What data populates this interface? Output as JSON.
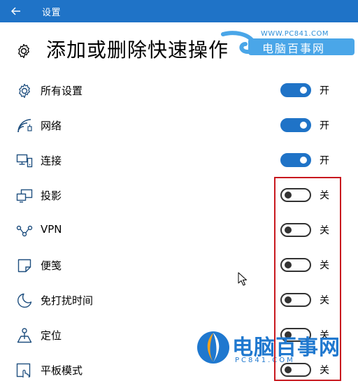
{
  "titlebar": {
    "title": "设置"
  },
  "header": {
    "title": "添加或删除快速操作"
  },
  "watermark_top": {
    "url": "WWW.PC841.COM",
    "name": "电脑百事网"
  },
  "watermark_bottom": {
    "name": "电脑百事网",
    "url": "PC841.COM"
  },
  "actions": [
    {
      "label": "所有设置",
      "icon": "gear-icon",
      "state": "开",
      "on": true
    },
    {
      "label": "网络",
      "icon": "wifi-icon",
      "state": "开",
      "on": true
    },
    {
      "label": "连接",
      "icon": "connect-icon",
      "state": "开",
      "on": true
    },
    {
      "label": "投影",
      "icon": "project-icon",
      "state": "关",
      "on": false
    },
    {
      "label": "VPN",
      "icon": "vpn-icon",
      "state": "关",
      "on": false
    },
    {
      "label": "便笺",
      "icon": "note-icon",
      "state": "关",
      "on": false
    },
    {
      "label": "免打扰时间",
      "icon": "moon-icon",
      "state": "关",
      "on": false
    },
    {
      "label": "定位",
      "icon": "location-icon",
      "state": "关",
      "on": false
    },
    {
      "label": "平板模式",
      "icon": "tablet-mode-icon",
      "state": "关",
      "on": false
    }
  ],
  "colors": {
    "accent": "#1f73c7",
    "highlight": "#c8181e"
  }
}
